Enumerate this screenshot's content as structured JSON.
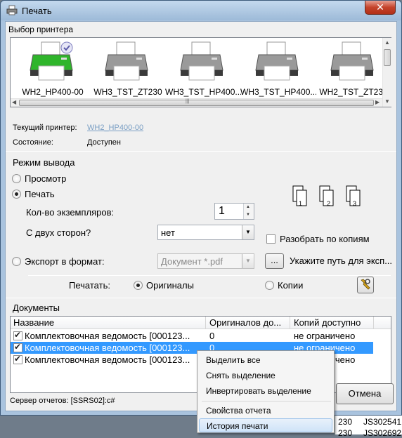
{
  "window": {
    "title": "Печать",
    "close_label": "✕"
  },
  "printer_group": {
    "label": "Выбор принтера",
    "printers": [
      {
        "name": "WH2_HP400-00",
        "color": "#2fb52b",
        "default": true
      },
      {
        "name": "WH3_TST_ZT230",
        "color": "#9a9a9a",
        "default": false
      },
      {
        "name": "WH3_TST_HP400...",
        "color": "#9a9a9a",
        "default": false
      },
      {
        "name": "WH3_TST_HP400...",
        "color": "#9a9a9a",
        "default": false
      },
      {
        "name": "WH2_TST_ZT230",
        "color": "#9a9a9a",
        "default": false
      }
    ],
    "current_label": "Текущий принтер:",
    "current_value": "WH2_HP400-00",
    "state_label": "Состояние:",
    "state_value": "Доступен"
  },
  "output_group": {
    "label": "Режим вывода",
    "preview_label": "Просмотр",
    "print_label": "Печать",
    "selected": "print",
    "copies_label": "Кол-во экземпляров:",
    "copies_value": "1",
    "duplex_label": "С двух сторон?",
    "duplex_value": "нет",
    "collate_label": "Разобрать по копиям",
    "collate_checked": false,
    "collate_pages": [
      "1",
      "2",
      "3"
    ],
    "export_label": "Экспорт в формат:",
    "export_format": "Документ *.pdf",
    "browse_label": "...",
    "export_path_label": "Укажите путь для эксп...",
    "print_what_label": "Печатать:",
    "originals_label": "Оригиналы",
    "copies_option_label": "Копии",
    "print_what_selected": "originals"
  },
  "documents_group": {
    "label": "Документы",
    "columns": [
      "Название",
      "Оригиналов до...",
      "Копий доступно"
    ],
    "rows": [
      {
        "checked": true,
        "name": "Комплектовочная ведомость [000123...",
        "originals": "0",
        "copies": "не ограничено",
        "selected": false
      },
      {
        "checked": true,
        "name": "Комплектовочная ведомость [000123...",
        "originals": "0",
        "copies": "не ограничено",
        "selected": true
      },
      {
        "checked": true,
        "name": "Комплектовочная ведомость [000123...",
        "originals": "0",
        "copies": "не ограничено",
        "selected": false
      }
    ]
  },
  "footer": {
    "server_status": "Сервер отчетов: [SSRS02]:c#",
    "cancel_label": "Отмена"
  },
  "context_menu": {
    "items": [
      "Выделить все",
      "Снять выделение",
      "Инвертировать выделение",
      "Свойства отчета",
      "История печати"
    ],
    "highlighted": "История печати"
  },
  "background_list": {
    "rows": [
      {
        "a": "230",
        "b": "JS302541"
      },
      {
        "a": "230",
        "b": "JS302692"
      }
    ]
  }
}
